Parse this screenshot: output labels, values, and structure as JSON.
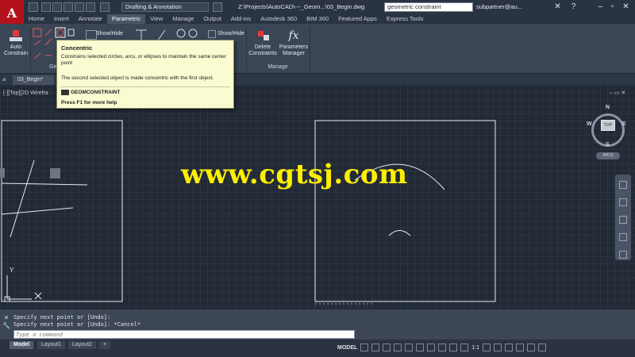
{
  "title_bar": {
    "workspace": "Drafting & Annotation",
    "file_path": "Z:\\Projects\\AutoCAD\\---_Geom...\\03_Begin.dwg",
    "search_value": "geometric constraint",
    "user": "subpartner@au...",
    "app_letter": "A"
  },
  "ribbon_tabs": [
    "Home",
    "Insert",
    "Annotate",
    "Parametric",
    "View",
    "Manage",
    "Output",
    "Add-ins",
    "Autodesk 360",
    "BIM 360",
    "Featured Apps",
    "Express Tools"
  ],
  "ribbon": {
    "auto_constrain": "Auto Constrain",
    "show_hide_1": "Show/Hide",
    "show_hide_2": "Show/Hide",
    "delete_constraints": "Delete Constraints",
    "parameters_manager": "Parameters Manager",
    "panel_geometric_partial": "Ge",
    "panel_manage": "Manage"
  },
  "tooltip": {
    "title": "Concentric",
    "description": "Constrains selected circles, arcs, or ellipses to maintain the same center point",
    "detail": "The second selected object is made concentric with the first object.",
    "command": "GEOMCONSTRAINT",
    "help": "Press F1 for more help"
  },
  "file_tab": "03_Begin*",
  "viewport": {
    "label": "[-][Top][2D Wirefra",
    "controls": "– ▭ ✕"
  },
  "viewcube": {
    "top": "TOP",
    "north": "N",
    "south": "S",
    "east": "E",
    "west": "W",
    "wcs": "WCS"
  },
  "ucs": {
    "y": "Y"
  },
  "watermark": "www.cgtsj.com",
  "command": {
    "history_1": "Specify next point or [Undo]:",
    "history_2": "Specify next point or [Undo]: *Cancel*",
    "placeholder": "Type a command"
  },
  "layout_tabs": [
    "Model",
    "Layout1",
    "Layout2"
  ],
  "add_layout": "+",
  "status": {
    "model": "MODEL",
    "scale": "1:1"
  }
}
